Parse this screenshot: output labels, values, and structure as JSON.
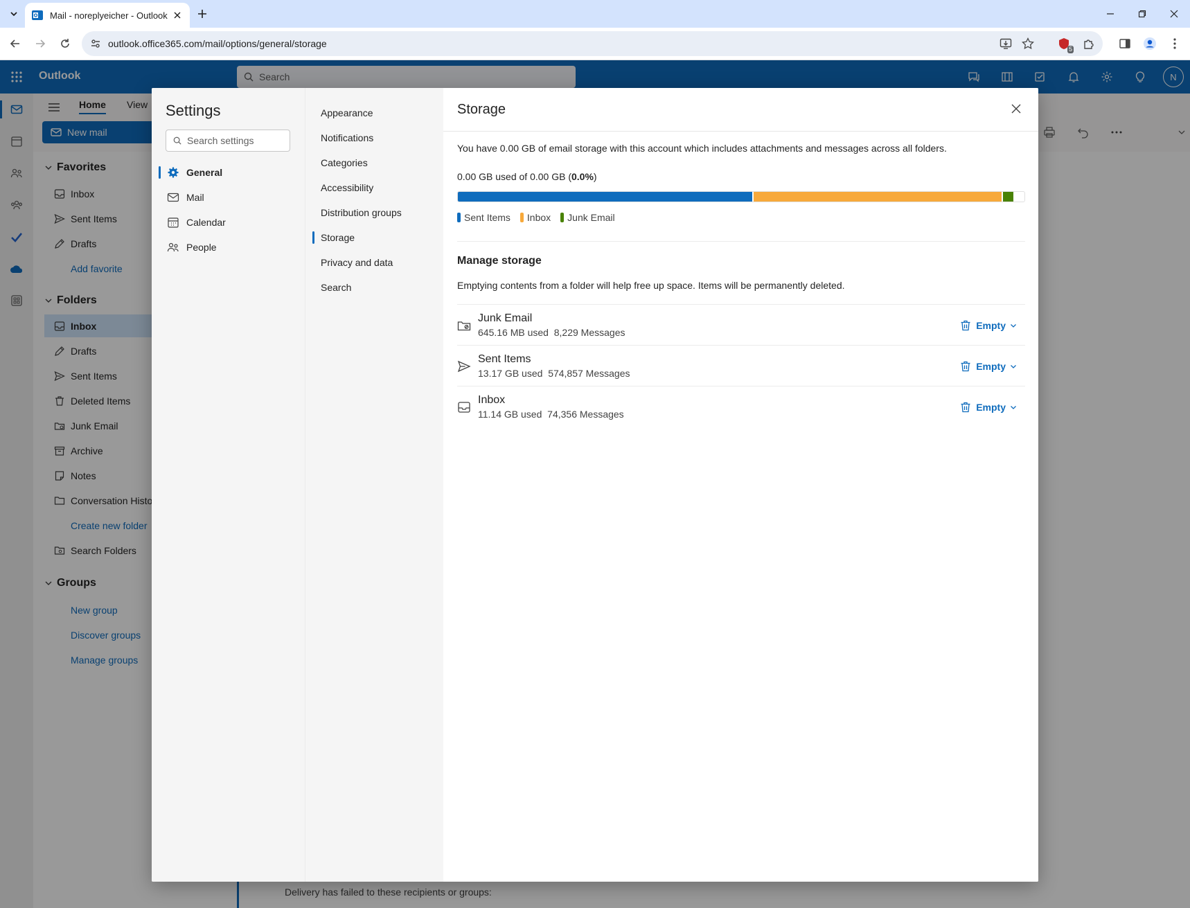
{
  "browser": {
    "tab_title": "Mail - noreplyeicher - Outlook",
    "url": "outlook.office365.com/mail/options/general/storage",
    "extension_badge": "5"
  },
  "app": {
    "name": "Outlook",
    "search_placeholder": "Search",
    "avatar_initial": "N",
    "accent_color": "#0f6cbd"
  },
  "ribbon": {
    "tabs": [
      "Home",
      "View"
    ],
    "new_mail_label": "New mail"
  },
  "folder_pane": {
    "favorites_label": "Favorites",
    "favorites": [
      {
        "label": "Inbox",
        "icon": "inbox-icon"
      },
      {
        "label": "Sent Items",
        "icon": "send-icon"
      },
      {
        "label": "Drafts",
        "icon": "draft-icon"
      }
    ],
    "add_favorite": "Add favorite",
    "folders_label": "Folders",
    "folders": [
      {
        "label": "Inbox",
        "icon": "inbox-icon",
        "selected": true
      },
      {
        "label": "Drafts",
        "icon": "draft-icon"
      },
      {
        "label": "Sent Items",
        "icon": "send-icon"
      },
      {
        "label": "Deleted Items",
        "icon": "trash-icon"
      },
      {
        "label": "Junk Email",
        "icon": "junk-icon"
      },
      {
        "label": "Archive",
        "icon": "archive-icon"
      },
      {
        "label": "Notes",
        "icon": "note-icon"
      },
      {
        "label": "Conversation History",
        "icon": "folder-icon"
      }
    ],
    "create_new_folder": "Create new folder",
    "search_folders": "Search Folders",
    "groups_label": "Groups",
    "groups_links": [
      "New group",
      "Discover groups",
      "Manage groups"
    ]
  },
  "message_fragment": {
    "text": "Delivery has failed to these recipients or groups:"
  },
  "settings": {
    "title": "Settings",
    "search_placeholder": "Search settings",
    "categories": [
      {
        "label": "General",
        "icon": "gear-icon",
        "active": true
      },
      {
        "label": "Mail",
        "icon": "mail-icon",
        "active": false
      },
      {
        "label": "Calendar",
        "icon": "calendar-icon",
        "active": false
      },
      {
        "label": "People",
        "icon": "people-icon",
        "active": false
      }
    ],
    "subcategories": [
      {
        "label": "Appearance",
        "active": false
      },
      {
        "label": "Notifications",
        "active": false
      },
      {
        "label": "Categories",
        "active": false
      },
      {
        "label": "Accessibility",
        "active": false
      },
      {
        "label": "Distribution groups",
        "active": false
      },
      {
        "label": "Storage",
        "active": true
      },
      {
        "label": "Privacy and data",
        "active": false
      },
      {
        "label": "Search",
        "active": false
      }
    ]
  },
  "storage": {
    "title": "Storage",
    "description": "You have 0.00 GB of email storage with this account which includes attachments and messages across all folders.",
    "usage_prefix": "0.00 GB used of 0.00 GB (",
    "usage_percent": "0.0%",
    "usage_suffix": ")",
    "bar_segments": [
      {
        "name": "Sent Items",
        "color": "#0f6cbd",
        "fraction": 0.52
      },
      {
        "name": "Inbox",
        "color": "#f7a93b",
        "fraction": 0.44
      },
      {
        "name": "Junk Email",
        "color": "#498205",
        "fraction": 0.02
      }
    ],
    "legend": [
      {
        "label": "Sent Items",
        "color": "#0f6cbd"
      },
      {
        "label": "Inbox",
        "color": "#f7a93b"
      },
      {
        "label": "Junk Email",
        "color": "#498205"
      }
    ],
    "manage_title": "Manage storage",
    "manage_description": "Emptying contents from a folder will help free up space. Items will be permanently deleted.",
    "empty_label": "Empty",
    "folders": [
      {
        "name": "Junk Email",
        "size": "645.16 MB used",
        "messages": "8,229 Messages",
        "icon": "junk-icon"
      },
      {
        "name": "Sent Items",
        "size": "13.17 GB used",
        "messages": "574,857 Messages",
        "icon": "send-icon"
      },
      {
        "name": "Inbox",
        "size": "11.14 GB used",
        "messages": "74,356 Messages",
        "icon": "inbox-icon"
      }
    ]
  }
}
